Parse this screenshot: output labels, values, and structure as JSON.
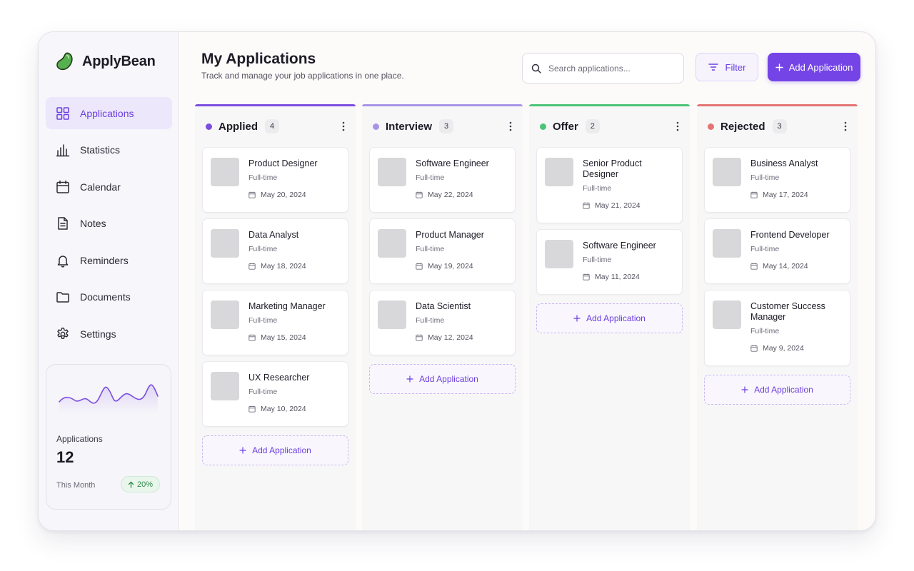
{
  "brand": {
    "name": "ApplyBean",
    "logo_icon": "bean-icon",
    "logo_color": "#4caf50"
  },
  "sidebar": {
    "items": [
      {
        "label": "Applications",
        "icon": "grid-icon",
        "active": true
      },
      {
        "label": "Statistics",
        "icon": "bar-chart-icon",
        "active": false
      },
      {
        "label": "Calendar",
        "icon": "calendar-icon",
        "active": false
      },
      {
        "label": "Notes",
        "icon": "notes-icon",
        "active": false
      },
      {
        "label": "Reminders",
        "icon": "bell-icon",
        "active": false
      },
      {
        "label": "Documents",
        "icon": "folder-icon",
        "active": false
      },
      {
        "label": "Settings",
        "icon": "gear-icon",
        "active": false
      }
    ],
    "stats": {
      "label": "Applications",
      "value": "12",
      "period": "This Month",
      "change": "20%",
      "change_icon": "arrow-up-icon"
    }
  },
  "header": {
    "title": "My Applications",
    "subtitle": "Track and manage your job applications in one place.",
    "search_placeholder": "Search applications...",
    "filter_label": "Filter",
    "add_label": "Add Application"
  },
  "colors": {
    "accent": "#7444e6",
    "applied": "#7b4ee0",
    "interview": "#a895e8",
    "offer": "#4cc477",
    "rejected": "#e57373"
  },
  "board": {
    "add_label": "Add Application",
    "columns": [
      {
        "title": "Applied",
        "count": "4",
        "cards": [
          {
            "title": "Product Designer",
            "type": "Full-time",
            "date": "May 20, 2024"
          },
          {
            "title": "Data Analyst",
            "type": "Full-time",
            "date": "May 18, 2024"
          },
          {
            "title": "Marketing Manager",
            "type": "Full-time",
            "date": "May 15, 2024"
          },
          {
            "title": "UX Researcher",
            "type": "Full-time",
            "date": "May 10, 2024"
          }
        ]
      },
      {
        "title": "Interview",
        "count": "3",
        "cards": [
          {
            "title": "Software Engineer",
            "type": "Full-time",
            "date": "May 22, 2024"
          },
          {
            "title": "Product Manager",
            "type": "Full-time",
            "date": "May 19, 2024"
          },
          {
            "title": "Data Scientist",
            "type": "Full-time",
            "date": "May 12, 2024"
          }
        ]
      },
      {
        "title": "Offer",
        "count": "2",
        "cards": [
          {
            "title": "Senior Product Designer",
            "type": "Full-time",
            "date": "May 21, 2024"
          },
          {
            "title": "Software Engineer",
            "type": "Full-time",
            "date": "May 11, 2024"
          }
        ]
      },
      {
        "title": "Rejected",
        "count": "3",
        "cards": [
          {
            "title": "Business Analyst",
            "type": "Full-time",
            "date": "May 17, 2024"
          },
          {
            "title": "Frontend Developer",
            "type": "Full-time",
            "date": "May 14, 2024"
          },
          {
            "title": "Customer Success Manager",
            "type": "Full-time",
            "date": "May 9, 2024"
          }
        ]
      }
    ]
  }
}
